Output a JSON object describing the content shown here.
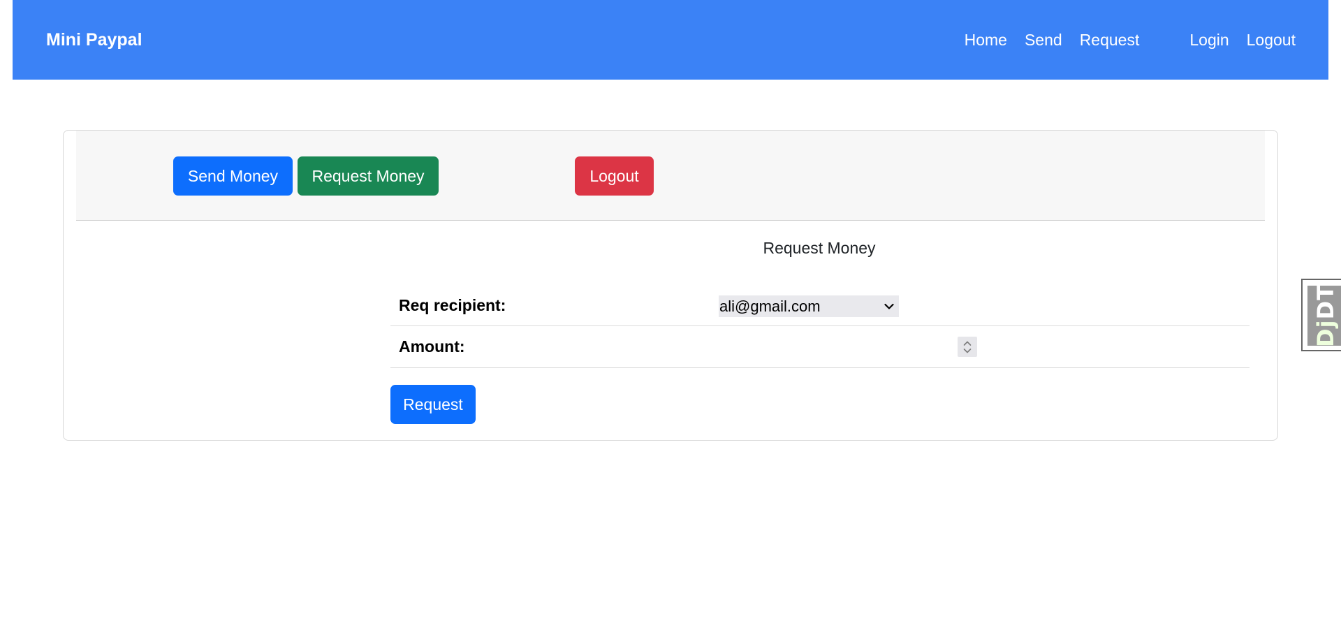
{
  "navbar": {
    "brand": "Mini Paypal",
    "links": [
      "Home",
      "Send",
      "Request",
      "Login",
      "Logout"
    ]
  },
  "card_header": {
    "send_money_label": "Send Money",
    "request_money_label": "Request Money",
    "logout_label": "Logout"
  },
  "form": {
    "title": "Request Money",
    "recipient_label": "Req recipient:",
    "recipient_value": "ali@gmail.com",
    "amount_label": "Amount:",
    "amount_value": "",
    "submit_label": "Request"
  },
  "debug_toolbar": {
    "dj": "Dj",
    "dt": "DT"
  },
  "colors": {
    "navbar": "#3b82f6",
    "primary": "#0d6efd",
    "success": "#198754",
    "danger": "#dc3545"
  }
}
